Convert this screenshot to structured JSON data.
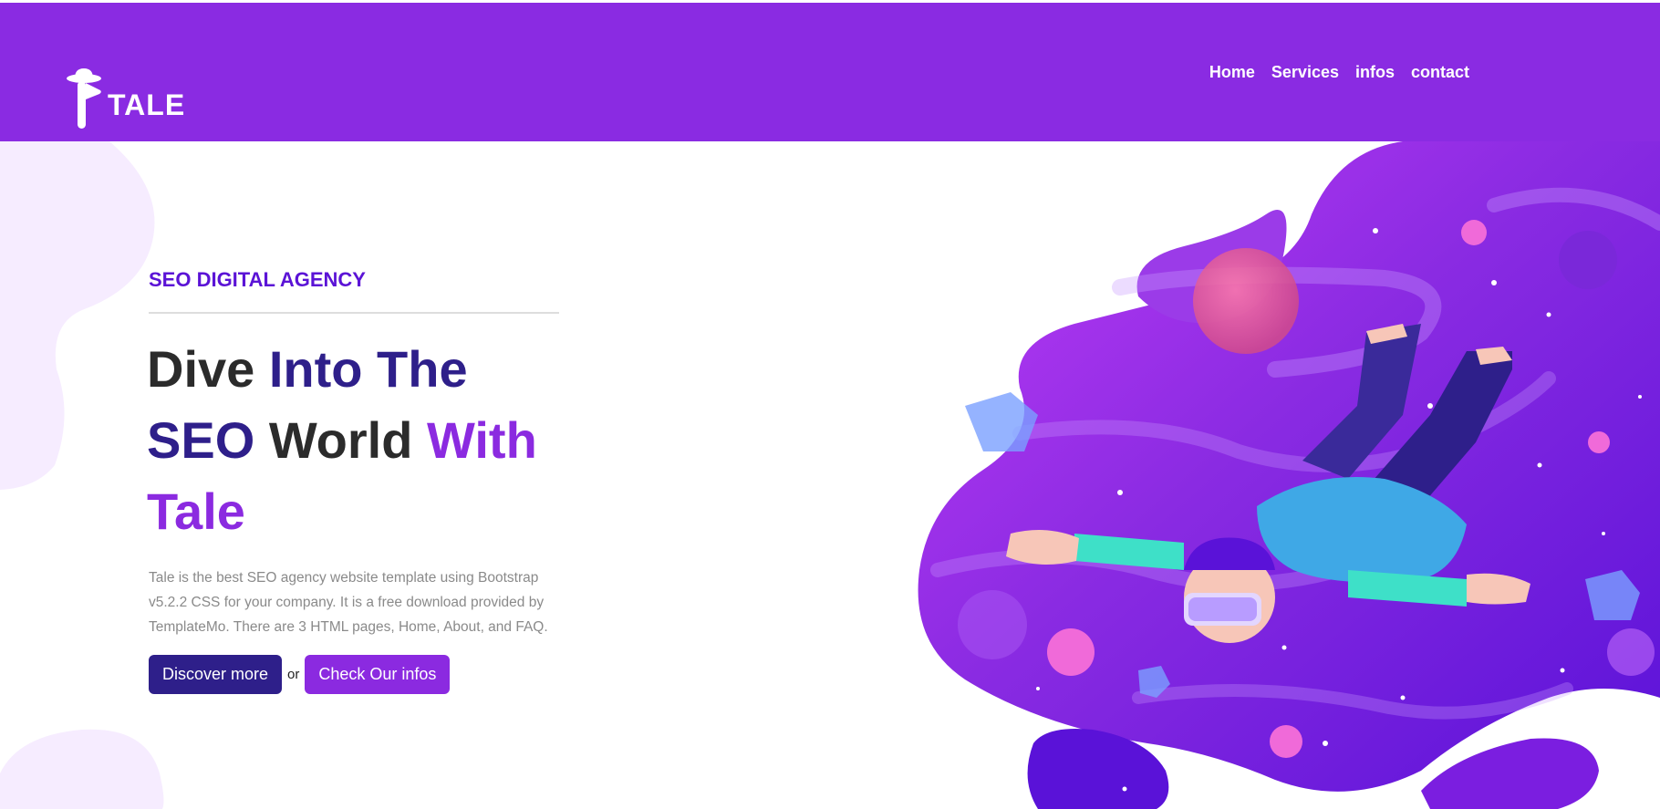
{
  "brand": {
    "name": "TALE"
  },
  "nav": {
    "items": [
      {
        "label": "Home"
      },
      {
        "label": "Services"
      },
      {
        "label": "infos"
      },
      {
        "label": "contact"
      }
    ]
  },
  "hero": {
    "eyebrow": "SEO DIGITAL AGENCY",
    "headline": [
      {
        "text": "Dive",
        "tone": "dark"
      },
      {
        "text": "Into The",
        "tone": "indigo"
      },
      {
        "text": "SEO",
        "tone": "indigo"
      },
      {
        "text": "World",
        "tone": "dark"
      },
      {
        "text": "With Tale",
        "tone": "violet"
      }
    ],
    "description": "Tale is the best SEO agency website template using Bootstrap v5.2.2 CSS for your company. It is a free download provided by TemplateMo. There are 3 HTML pages, Home, About, and FAQ.",
    "primary_button": "Discover more",
    "or_text": "or",
    "secondary_button": "Check Our infos"
  },
  "colors": {
    "navbar": "#8a2be2",
    "eyebrow": "#5b13d6",
    "heading_dark": "#2b2b2b",
    "heading_indigo": "#2e1f8a",
    "heading_violet": "#8b2ae0",
    "button_primary": "#2e1f8a",
    "button_secondary": "#8b2ae0",
    "body_text": "#8a8a8a",
    "blob_light": "#f6ecff"
  },
  "icons": {
    "logo": "tale-hat-logo-icon",
    "illustration": "vr-astronaut-floating-illustration"
  }
}
